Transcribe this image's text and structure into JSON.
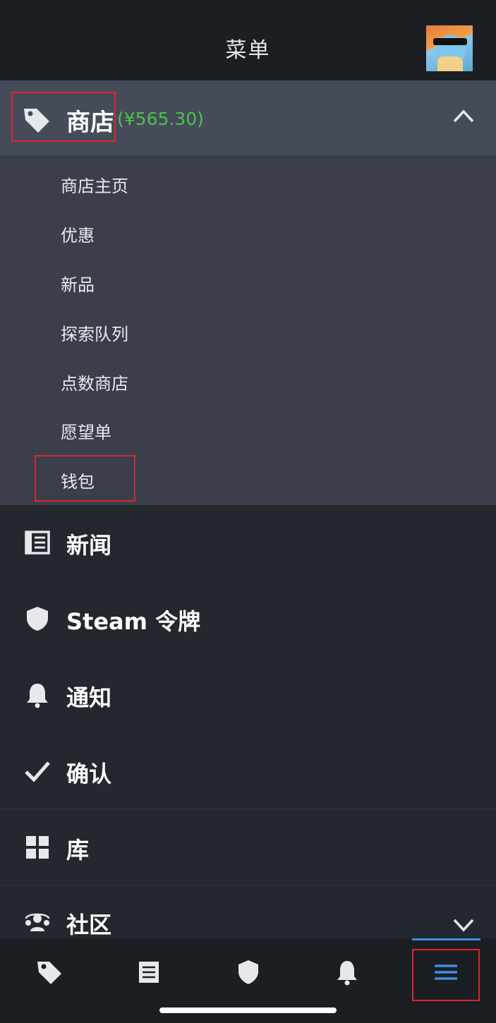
{
  "header": {
    "title": "菜单"
  },
  "store": {
    "label": "商店",
    "balance": "(¥565.30)",
    "items": [
      "商店主页",
      "优惠",
      "新品",
      "探索队列",
      "点数商店",
      "愿望单",
      "钱包"
    ]
  },
  "menu": [
    {
      "label": "新闻",
      "icon": "news-icon"
    },
    {
      "label": "Steam 令牌",
      "icon": "shield-icon"
    },
    {
      "label": "通知",
      "icon": "bell-icon"
    },
    {
      "label": "确认",
      "icon": "check-icon"
    },
    {
      "label": "库",
      "icon": "grid-icon"
    },
    {
      "label": "社区",
      "icon": "community-icon"
    }
  ],
  "tabbar": {
    "tabs": [
      "store-tag-icon",
      "news-icon",
      "shield-icon",
      "bell-icon",
      "menu-icon"
    ],
    "active": "menu-icon"
  },
  "colors": {
    "balance": "#4cc44c",
    "highlight_box": "#e0232e",
    "active_tab": "#3d8ee6"
  }
}
